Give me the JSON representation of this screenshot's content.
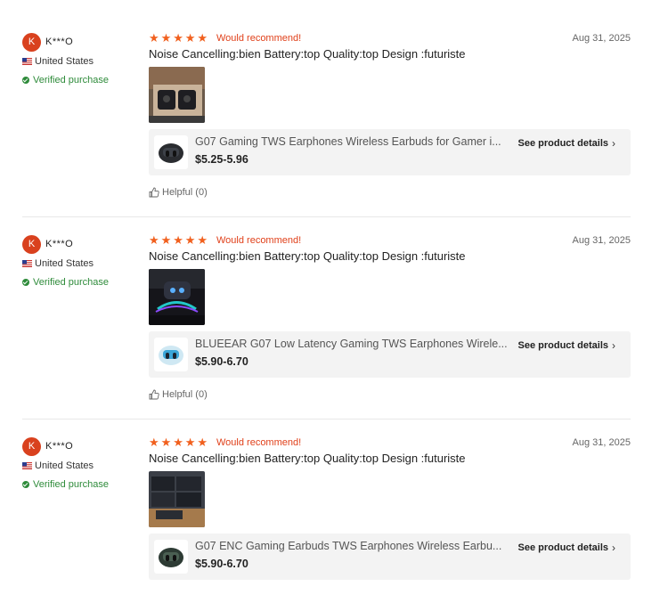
{
  "reviews": [
    {
      "avatar_letter": "K",
      "username": "K***O",
      "country": "United States",
      "verified": "Verified purchase",
      "recommend": "Would recommend!",
      "date": "Aug 31, 2025",
      "text": "Noise Cancelling:bien Battery:top Quality:top Design :futuriste",
      "product_title": "G07 Gaming TWS Earphones Wireless Earbuds for Gamer i...",
      "product_price": "$5.25-5.96",
      "details_label": "See product details",
      "helpful": "Helpful (0)"
    },
    {
      "avatar_letter": "K",
      "username": "K***O",
      "country": "United States",
      "verified": "Verified purchase",
      "recommend": "Would recommend!",
      "date": "Aug 31, 2025",
      "text": "Noise Cancelling:bien Battery:top Quality:top Design :futuriste",
      "product_title": "BLUEEAR G07 Low Latency Gaming TWS Earphones Wirele...",
      "product_price": "$5.90-6.70",
      "details_label": "See product details",
      "helpful": "Helpful (0)"
    },
    {
      "avatar_letter": "K",
      "username": "K***O",
      "country": "United States",
      "verified": "Verified purchase",
      "recommend": "Would recommend!",
      "date": "Aug 31, 2025",
      "text": "Noise Cancelling:bien Battery:top Quality:top Design :futuriste",
      "product_title": "G07 ENC Gaming Earbuds TWS Earphones Wireless Earbu...",
      "product_price": "$5.90-6.70",
      "details_label": "See product details"
    }
  ],
  "colors": {
    "accent": "#f1601e",
    "verified": "#2e8b3a",
    "avatar": "#d9411e"
  },
  "icons": [
    "star-icon",
    "flag-us-icon",
    "verified-check-icon",
    "chevron-right-icon",
    "thumbs-up-icon"
  ]
}
